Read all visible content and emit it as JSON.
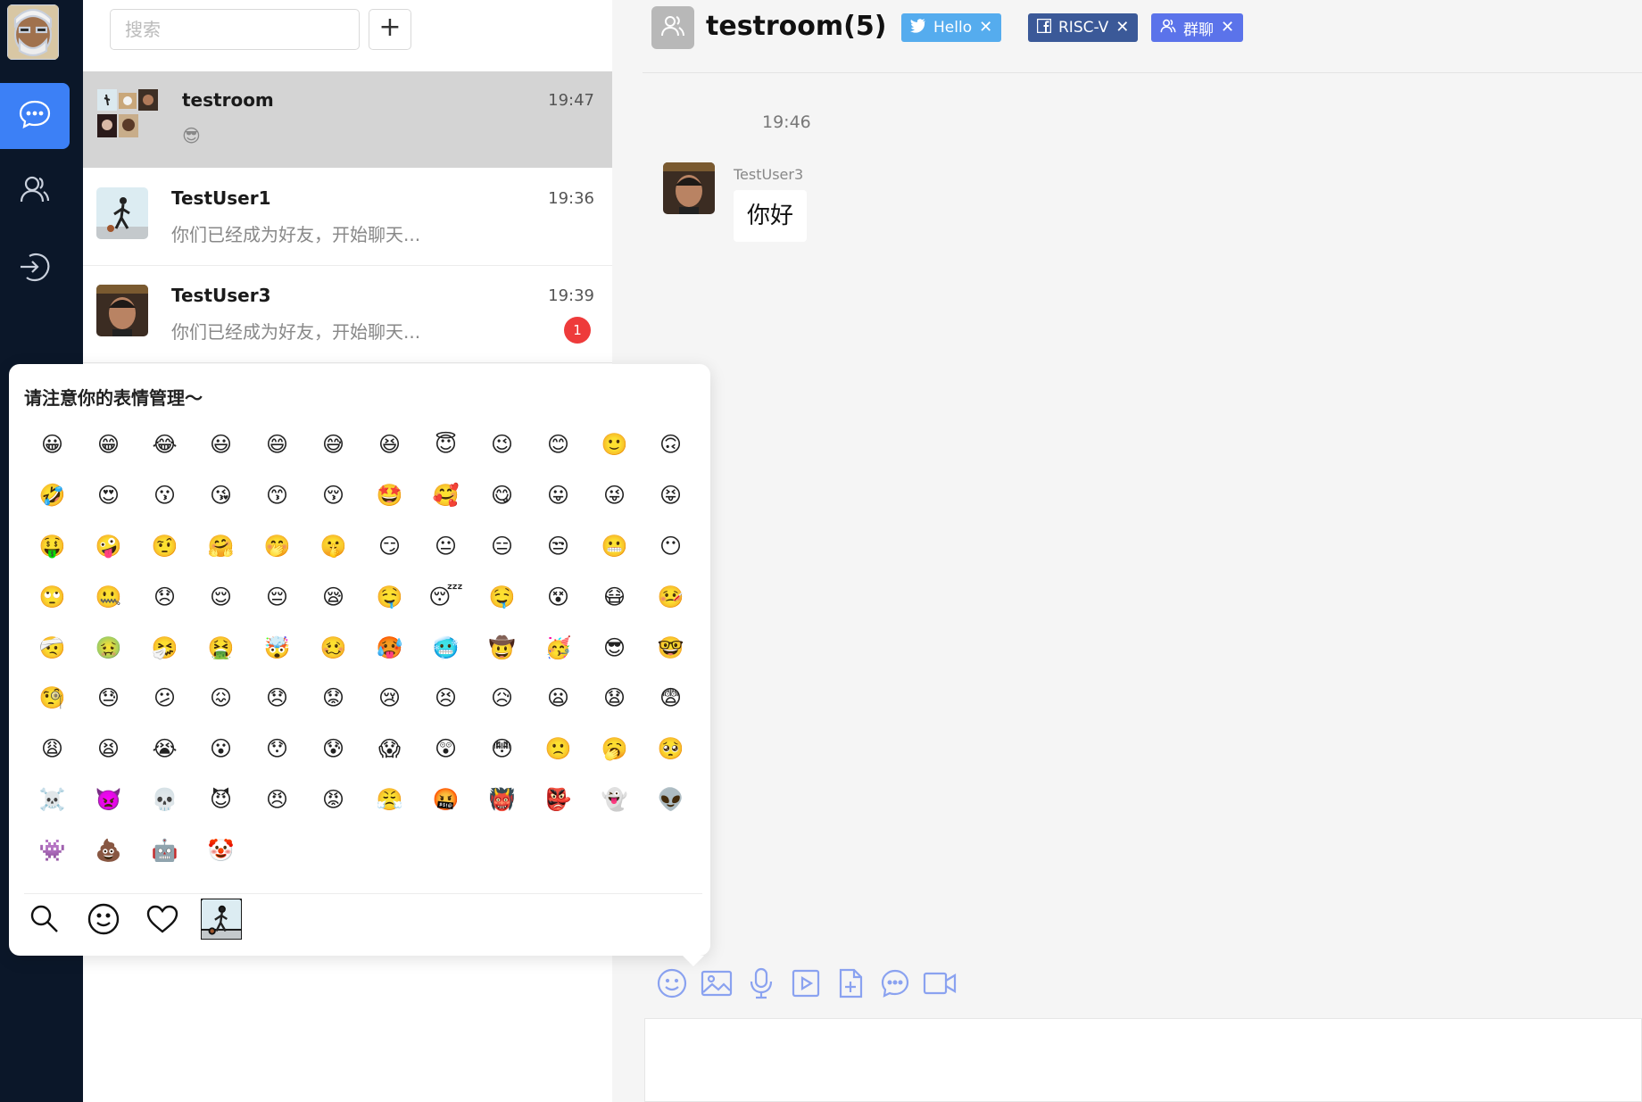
{
  "sidebar": {
    "nav_items": [
      {
        "icon": "chat-bubble-icon",
        "active": true
      },
      {
        "icon": "contacts-icon",
        "active": false
      },
      {
        "icon": "logout-icon",
        "active": false
      }
    ]
  },
  "conversation_list": {
    "search_placeholder": "搜索",
    "add_label": "+",
    "items": [
      {
        "name": "testroom",
        "time": "19:47",
        "preview": "😎",
        "selected": true
      },
      {
        "name": "TestUser1",
        "time": "19:36",
        "preview": "你们已经成为好友，开始聊天...",
        "selected": false
      },
      {
        "name": "TestUser3",
        "time": "19:39",
        "preview": "你们已经成为好友，开始聊天...",
        "unread": "1",
        "selected": false
      }
    ]
  },
  "chat": {
    "room_title": "testroom(5)",
    "tags": [
      {
        "label": "Hello",
        "icon": "twitter-icon",
        "color": "#55acee"
      },
      {
        "label": "RISC-V",
        "icon": "facebook-icon",
        "color": "#3b5998"
      },
      {
        "label": "群聊",
        "icon": "group-icon",
        "color": "#5b73ea"
      }
    ],
    "message": {
      "time": "19:46",
      "sender": "TestUser3",
      "text": "你好"
    }
  },
  "emoji_panel": {
    "title": "请注意你的表情管理～",
    "emojis": [
      "😀",
      "😁",
      "😂",
      "😃",
      "😄",
      "😅",
      "😆",
      "😇",
      "😉",
      "😊",
      "🙂",
      "🙃",
      "🤣",
      "😍",
      "😗",
      "😘",
      "😙",
      "😚",
      "🤩",
      "🥰",
      "😋",
      "😛",
      "😜",
      "😝",
      "🤑",
      "🤪",
      "🤨",
      "🤗",
      "🤭",
      "🤫",
      "😏",
      "😐",
      "😑",
      "😒",
      "😬",
      "😶",
      "🙄",
      "🤐",
      "😞",
      "😌",
      "😔",
      "😪",
      "🤤",
      "😴",
      "🤤",
      "😵",
      "😷",
      "🤒",
      "🤕",
      "🤢",
      "🤧",
      "🤮",
      "🤯",
      "🥴",
      "🥵",
      "🥶",
      "🤠",
      "🥳",
      "😎",
      "🤓",
      "🧐",
      "😓",
      "😕",
      "😖",
      "😞",
      "😟",
      "😢",
      "😣",
      "😥",
      "😦",
      "😧",
      "😨",
      "😩",
      "😫",
      "😭",
      "😮",
      "😯",
      "😰",
      "😱",
      "😲",
      "😳",
      "🙁",
      "🥱",
      "🥺",
      "☠️",
      "👿",
      "💀",
      "😈",
      "😠",
      "😡",
      "😤",
      "🤬",
      "👹",
      "👺",
      "👻",
      "👽",
      "👾",
      "💩",
      "🤖",
      "🤡"
    ],
    "tabs": [
      "search-icon",
      "smiley-icon",
      "heart-icon",
      "sticker-thumb"
    ]
  },
  "input_toolbar": {
    "tools": [
      "emoji-icon",
      "image-icon",
      "microphone-icon",
      "video-file-icon",
      "file-add-icon",
      "more-chat-icon",
      "video-call-icon"
    ]
  },
  "colors": {
    "rail_bg": "#0b1729",
    "accent": "#3c80f6",
    "selected_row": "#d4d4d4",
    "badge": "#ee3b3b"
  }
}
